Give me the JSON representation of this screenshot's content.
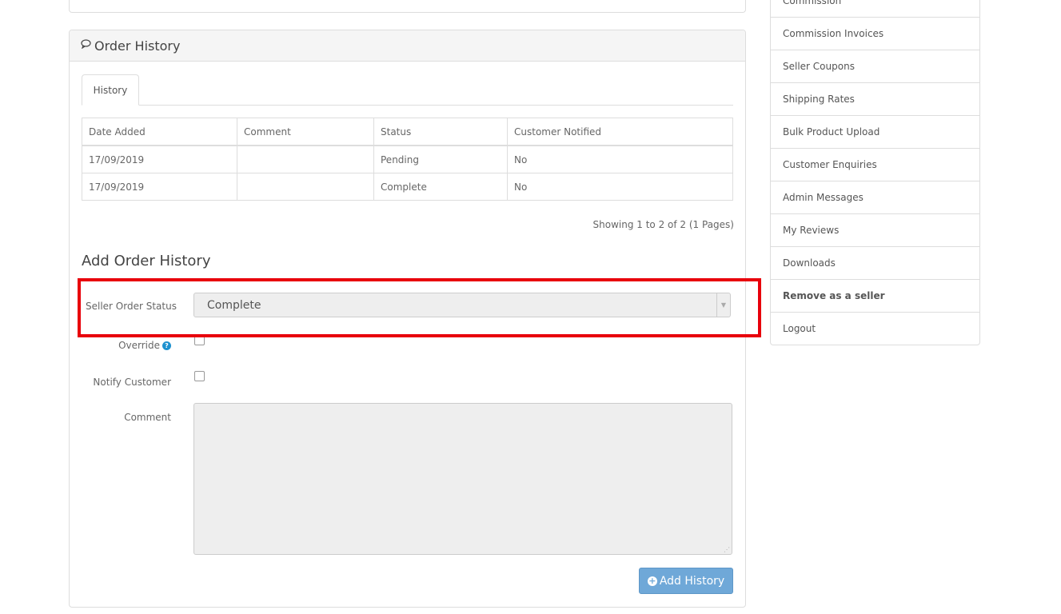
{
  "order_history": {
    "title": "Order History",
    "tab": "History",
    "columns": [
      "Date Added",
      "Comment",
      "Status",
      "Customer Notified"
    ],
    "rows": [
      [
        "17/09/2019",
        "",
        "Pending",
        "No"
      ],
      [
        "17/09/2019",
        "",
        "Complete",
        "No"
      ]
    ],
    "showing": "Showing 1 to 2 of 2 (1 Pages)"
  },
  "add_history": {
    "title": "Add Order History",
    "status_label": "Seller Order Status",
    "status_value": "Complete",
    "override_label": "Override",
    "notify_label": "Notify Customer",
    "comment_label": "Comment",
    "button": "Add History"
  },
  "sidebar": {
    "items": [
      "Commission",
      "Commission Invoices",
      "Seller Coupons",
      "Shipping Rates",
      "Bulk Product Upload",
      "Customer Enquiries",
      "Admin Messages",
      "My Reviews",
      "Downloads",
      "Remove as a seller",
      "Logout"
    ]
  },
  "colors": {
    "highlight": "#e8000b",
    "button": "#6fa8d8",
    "help": "#1e91cf"
  }
}
